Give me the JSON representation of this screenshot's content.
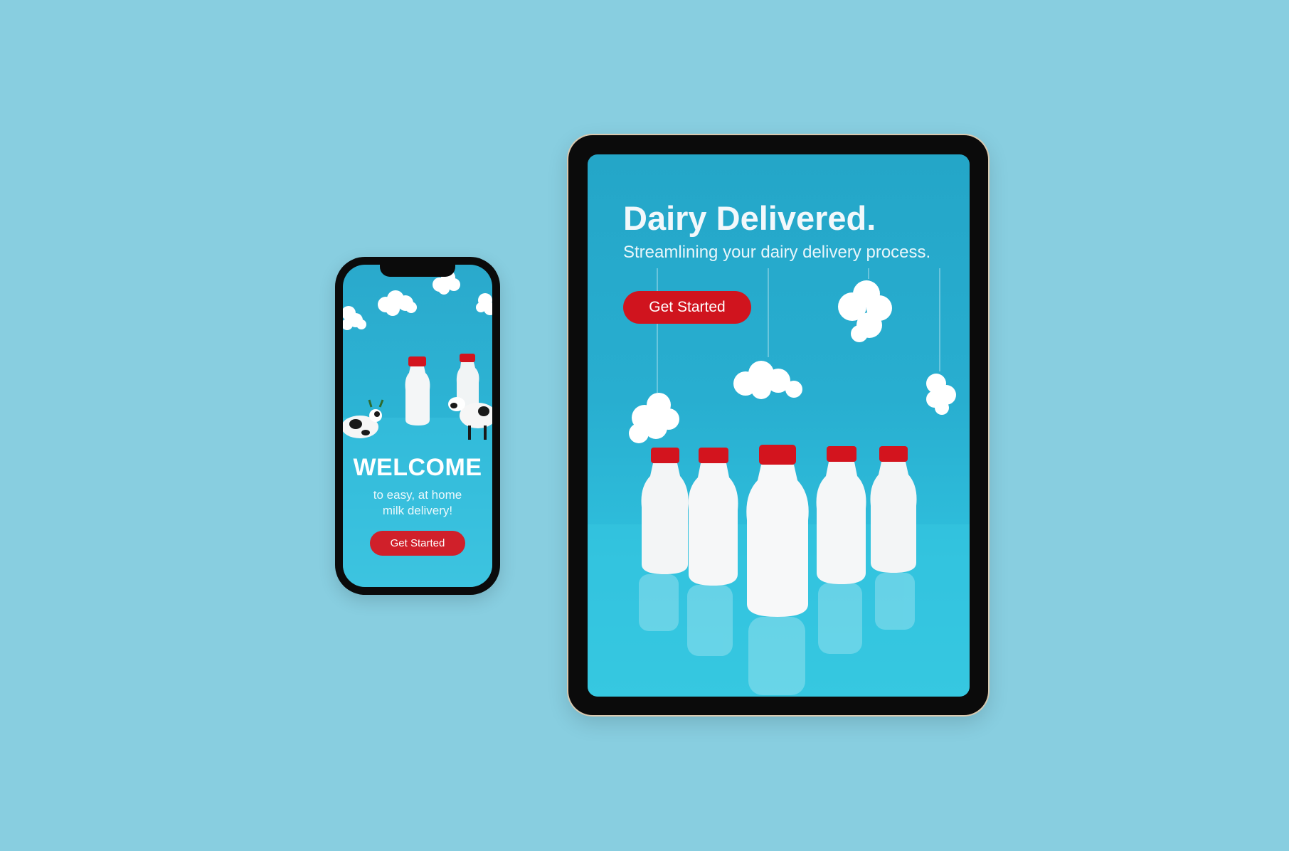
{
  "colors": {
    "background": "#88cee0",
    "screen_blue": "#2aa9cc",
    "accent_red": "#d0202a",
    "device_frame": "#0b0b0b"
  },
  "phone": {
    "title": "WELCOME",
    "subtitle_line1": "to easy, at home",
    "subtitle_line2": "milk delivery!",
    "cta_label": "Get Started"
  },
  "tablet": {
    "title": "Dairy Delivered.",
    "subtitle": "Streamlining your dairy delivery process.",
    "cta_label": "Get Started"
  },
  "icons": {
    "cloud": "cloud-icon",
    "bottle": "milk-bottle-icon",
    "cow": "cow-figurine-icon"
  }
}
